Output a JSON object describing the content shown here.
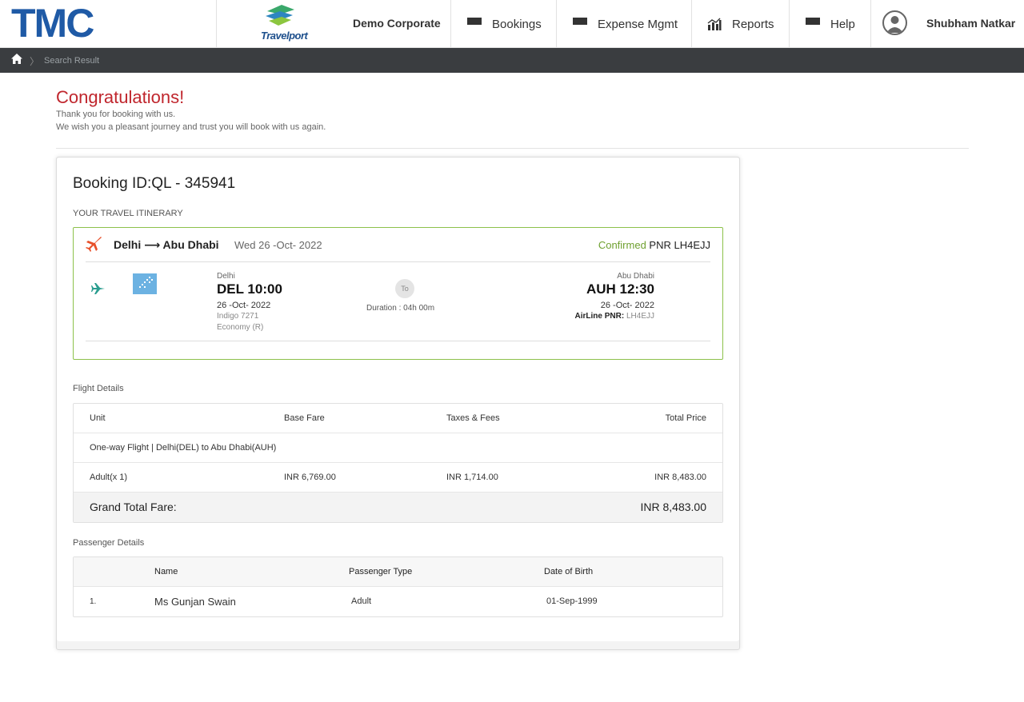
{
  "header": {
    "logo_text": "TMC",
    "partner_logo_text": "Travelport",
    "corporate_name": "Demo Corporate",
    "nav": [
      {
        "label": "Bookings",
        "icon": "menu-icon"
      },
      {
        "label": "Expense Mgmt",
        "icon": "menu-icon"
      },
      {
        "label": "Reports",
        "icon": "bar-chart-icon"
      },
      {
        "label": "Help",
        "icon": "menu-icon"
      }
    ],
    "user_name": "Shubham Natkar"
  },
  "breadcrumb": {
    "current": "Search Result"
  },
  "confirmation": {
    "title": "Congratulations!",
    "line1": "Thank you for booking with us.",
    "line2": "We wish you a pleasant journey and trust you will book with us again."
  },
  "booking": {
    "id_label": "Booking ID:QL - 345941",
    "itinerary_label": "YOUR TRAVEL ITINERARY",
    "route": "Delhi ⟶ Abu Dhabi",
    "date": "Wed 26 -Oct- 2022",
    "status": "Confirmed",
    "pnr_label": "PNR LH4EJJ",
    "departure": {
      "city": "Delhi",
      "time": "DEL 10:00",
      "date": "26 -Oct- 2022",
      "flight": "Indigo 7271",
      "cabin": "Economy (R)"
    },
    "to_label": "To",
    "duration": "Duration : 04h 00m",
    "arrival": {
      "city": "Abu Dhabi",
      "time": "AUH 12:30",
      "date": "26 -Oct- 2022",
      "airline_pnr_label": "AirLine PNR:",
      "airline_pnr": "LH4EJJ"
    }
  },
  "flight_details": {
    "label": "Flight Details",
    "headers": {
      "unit": "Unit",
      "base": "Base Fare",
      "taxes": "Taxes & Fees",
      "total": "Total Price"
    },
    "trip": "One-way Flight | Delhi(DEL) to Abu Dhabi(AUH)",
    "row": {
      "unit": "Adult(x 1)",
      "base": "INR 6,769.00",
      "taxes": "INR 1,714.00",
      "total": "INR 8,483.00"
    },
    "grand_label": "Grand Total Fare:",
    "grand_value": "INR 8,483.00"
  },
  "passenger_details": {
    "label": "Passenger Details",
    "headers": {
      "name": "Name",
      "type": "Passenger Type",
      "dob": "Date of Birth"
    },
    "rows": [
      {
        "index": "1.",
        "name": "Ms Gunjan Swain",
        "type": "Adult",
        "dob": "01-Sep-1999"
      }
    ]
  },
  "colors": {
    "brand_blue": "#1f5aa6",
    "congrats_red": "#c0262d",
    "confirmed_green": "#6fa030",
    "breadcrumb_bg": "#3a3d40"
  }
}
